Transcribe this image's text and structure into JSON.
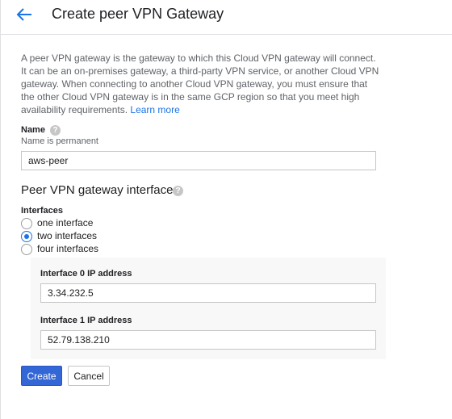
{
  "header": {
    "title": "Create peer VPN Gateway",
    "back_icon": "arrow-back-icon"
  },
  "description": {
    "text": "A peer VPN gateway is the gateway to which this Cloud VPN gateway will connect. It can be an on-premises gateway, a third-party VPN service, or another Cloud VPN gateway. When connecting to another Cloud VPN gateway, you must ensure that the other Cloud VPN gateway is in the same GCP region so that you meet high availability requirements.",
    "link": "Learn more"
  },
  "name_field": {
    "label": "Name",
    "help": "?",
    "sublabel": "Name is permanent",
    "value": "aws-peer"
  },
  "interfaces_section": {
    "title": "Peer VPN gateway interfaces",
    "help": "?",
    "label": "Interfaces",
    "options": [
      {
        "label": "one interface",
        "checked": false
      },
      {
        "label": "two interfaces",
        "checked": true
      },
      {
        "label": "four interfaces",
        "checked": false
      }
    ],
    "interface0": {
      "label": "Interface 0 IP address",
      "value": "3.34.232.5"
    },
    "interface1": {
      "label": "Interface 1 IP address",
      "value": "52.79.138.210"
    }
  },
  "actions": {
    "create": "Create",
    "cancel": "Cancel"
  },
  "colors": {
    "accent": "#1a73e8",
    "primary_button": "#3367d6"
  }
}
